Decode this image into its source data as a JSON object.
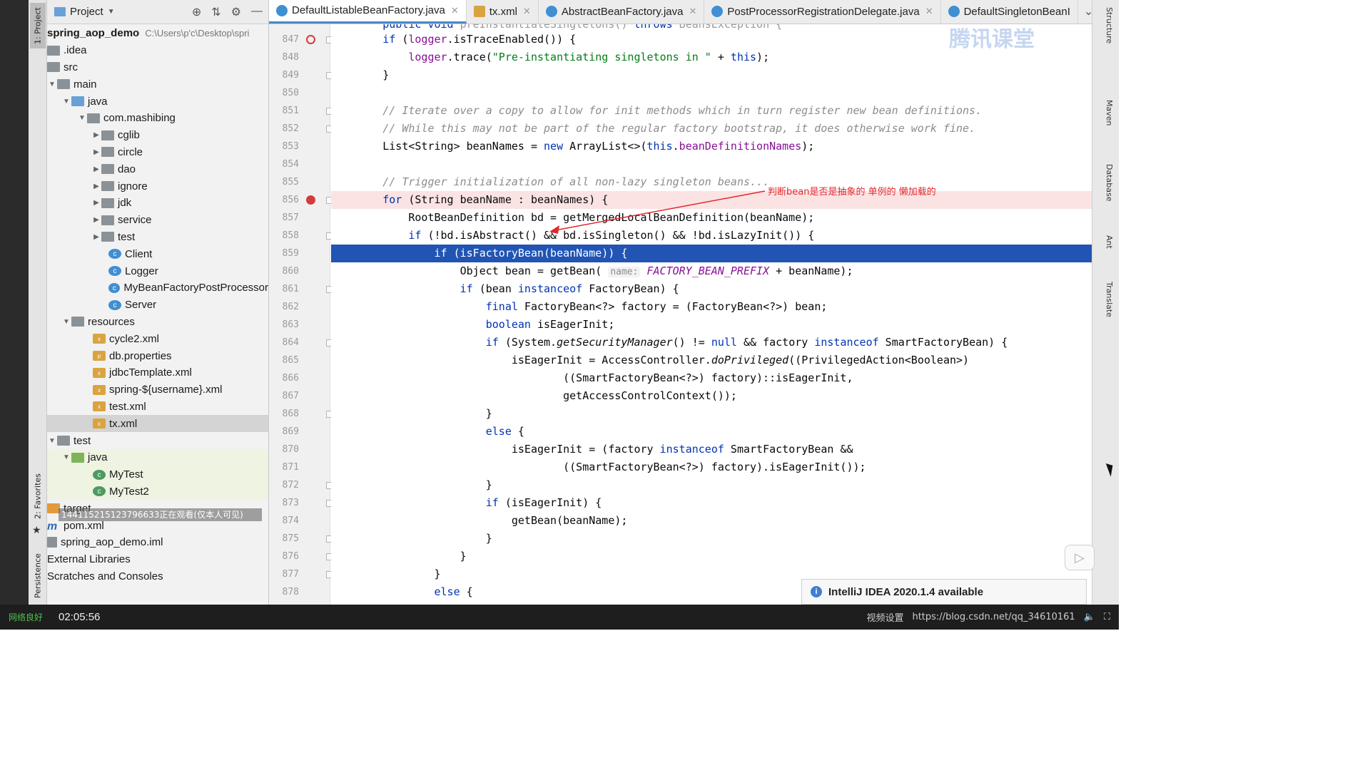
{
  "project_panel": {
    "title": "Project",
    "tree": [
      {
        "label": "spring_aop_demo",
        "path": "C:\\Users\\p'c\\Desktop\\spri",
        "bold": true
      },
      {
        "label": ".idea"
      },
      {
        "label": "src"
      },
      {
        "label": "main"
      },
      {
        "label": "java"
      },
      {
        "label": "com.mashibing"
      },
      {
        "label": "cglib"
      },
      {
        "label": "circle"
      },
      {
        "label": "dao"
      },
      {
        "label": "ignore"
      },
      {
        "label": "jdk"
      },
      {
        "label": "service"
      },
      {
        "label": "test"
      },
      {
        "label": "Client"
      },
      {
        "label": "Logger"
      },
      {
        "label": "MyBeanFactoryPostProcessor"
      },
      {
        "label": "Server"
      },
      {
        "label": "resources"
      },
      {
        "label": "cycle2.xml"
      },
      {
        "label": "db.properties"
      },
      {
        "label": "jdbcTemplate.xml"
      },
      {
        "label": "spring-${username}.xml"
      },
      {
        "label": "test.xml"
      },
      {
        "label": "tx.xml"
      },
      {
        "label": "test"
      },
      {
        "label": "java"
      },
      {
        "label": "MyTest"
      },
      {
        "label": "MyTest2"
      },
      {
        "label": "target"
      },
      {
        "label": "pom.xml"
      },
      {
        "label": "spring_aop_demo.iml"
      },
      {
        "label": "External Libraries"
      },
      {
        "label": "Scratches and Consoles"
      }
    ],
    "overlay_text": "144115215123796633正在观看(仅本人可见)"
  },
  "left_tool_tabs": {
    "project": "1: Project",
    "favorites": "2: Favorites",
    "persistence": "Persistence"
  },
  "tabs": [
    {
      "label": "DefaultListableBeanFactory.java",
      "active": true
    },
    {
      "label": "tx.xml"
    },
    {
      "label": "AbstractBeanFactory.java"
    },
    {
      "label": "PostProcessorRegistrationDelegate.java"
    },
    {
      "label": "DefaultSingletonBeanI"
    }
  ],
  "editor": {
    "line_numbers": [
      "847",
      "848",
      "849",
      "850",
      "851",
      "852",
      "853",
      "854",
      "855",
      "856",
      "857",
      "858",
      "859",
      "860",
      "861",
      "862",
      "863",
      "864",
      "865",
      "866",
      "867",
      "868",
      "869",
      "870",
      "871",
      "872",
      "873",
      "874",
      "875",
      "876",
      "877",
      "878"
    ],
    "breakpoint_line": "856",
    "execution_line": "859",
    "annotation": "判断bean是否是抽象的 单例的  懒加载的",
    "param_hint": "name:"
  },
  "right_tool_tabs": [
    "Structure",
    "Maven",
    "Database",
    "Ant",
    "Translate"
  ],
  "notification": {
    "text": "IntelliJ IDEA 2020.1.4 available"
  },
  "watermark": "腾讯课堂",
  "player": {
    "network": "网络良好",
    "time": "02:05:56",
    "settings": "视频设置",
    "url_watermark": "https://blog.csdn.net/qq_34610161"
  },
  "icons": [
    "target-icon",
    "collapse-icon",
    "gear-icon",
    "minimize-icon",
    "chevron-down-icon",
    "info-icon",
    "play-icon",
    "star-icon"
  ]
}
